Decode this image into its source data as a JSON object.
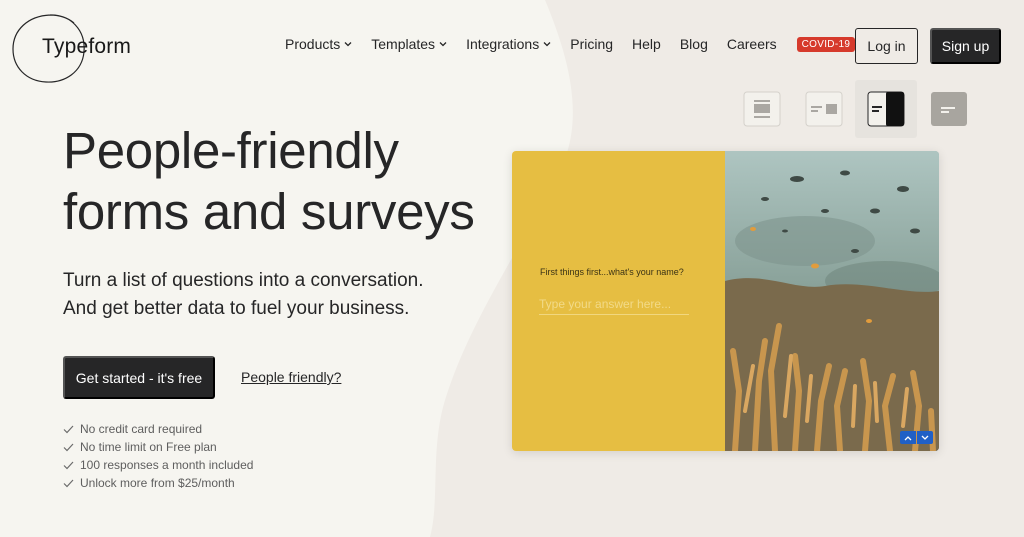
{
  "brand": {
    "name": "Typeform"
  },
  "nav": {
    "items": [
      {
        "label": "Products",
        "dropdown": true
      },
      {
        "label": "Templates",
        "dropdown": true
      },
      {
        "label": "Integrations",
        "dropdown": true
      },
      {
        "label": "Pricing",
        "dropdown": false
      },
      {
        "label": "Help",
        "dropdown": false
      },
      {
        "label": "Blog",
        "dropdown": false
      },
      {
        "label": "Careers",
        "dropdown": false
      }
    ],
    "badge": "COVID-19",
    "login_label": "Log in",
    "signup_label": "Sign up"
  },
  "hero": {
    "title_line1": "People-friendly",
    "title_line2": "forms and surveys",
    "subtitle_line1": "Turn a list of questions into a conversation.",
    "subtitle_line2": "And get better data to fuel your business.",
    "cta_label": "Get started - it's free",
    "link_label": "People friendly?",
    "checks": [
      "No credit card required",
      "No time limit on Free plan",
      "100 responses a month included",
      "Unlock more from $25/month"
    ]
  },
  "layouts": {
    "icons": [
      "layout-stack-icon",
      "layout-split-icon",
      "layout-half-image-icon",
      "layout-minimal-icon"
    ],
    "active_index": 2
  },
  "preview": {
    "question": "First things first...what's your name?",
    "placeholder": "Type your answer here...",
    "accent_color": "#e6be42",
    "nav_color": "#2060c6"
  },
  "colors": {
    "ink": "#262627",
    "background": "#f6f5f0",
    "badge": "#d63a2c"
  }
}
